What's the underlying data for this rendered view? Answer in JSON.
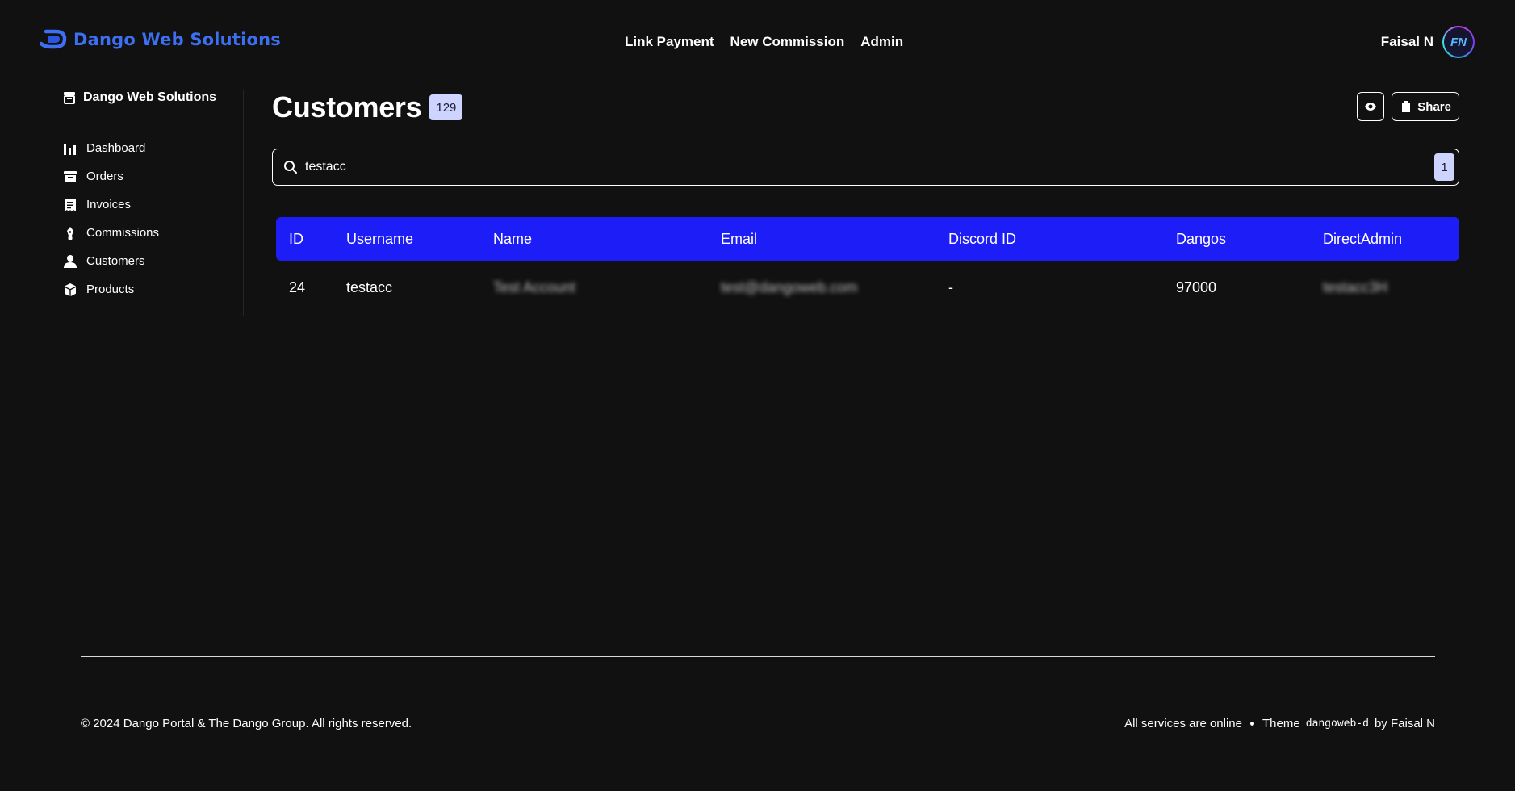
{
  "brand": {
    "name": "Dango Web Solutions",
    "color": "#3d6ff2"
  },
  "nav": {
    "items": [
      "Link Payment",
      "New Commission",
      "Admin"
    ]
  },
  "user": {
    "name": "Faisal N",
    "initials": "FN"
  },
  "sidebar": {
    "org": "Dango Web Solutions",
    "items": [
      {
        "label": "Dashboard",
        "icon": "chart-bar-icon"
      },
      {
        "label": "Orders",
        "icon": "box-icon"
      },
      {
        "label": "Invoices",
        "icon": "receipt-icon"
      },
      {
        "label": "Commissions",
        "icon": "pen-nib-icon"
      },
      {
        "label": "Customers",
        "icon": "user-icon"
      },
      {
        "label": "Products",
        "icon": "cube-icon"
      }
    ]
  },
  "page": {
    "title": "Customers",
    "count": "129"
  },
  "actions": {
    "share_label": "Share"
  },
  "search": {
    "value": "testacc",
    "result_count": "1"
  },
  "table": {
    "columns": [
      "ID",
      "Username",
      "Name",
      "Email",
      "Discord ID",
      "Dangos",
      "DirectAdmin"
    ],
    "rows": [
      {
        "id": "24",
        "username": "testacc",
        "name": "Test Account",
        "email": "test@dangoweb.com",
        "discord_id": "-",
        "dangos": "97000",
        "directadmin": "testacc3H"
      }
    ],
    "header_color": "#1d1df8"
  },
  "footer": {
    "copyright": "© 2024 Dango Portal & The Dango Group. All rights reserved.",
    "status": "All services are online",
    "theme_prefix": "Theme",
    "theme_name": "dangoweb-d",
    "by": "by Faisal N"
  }
}
